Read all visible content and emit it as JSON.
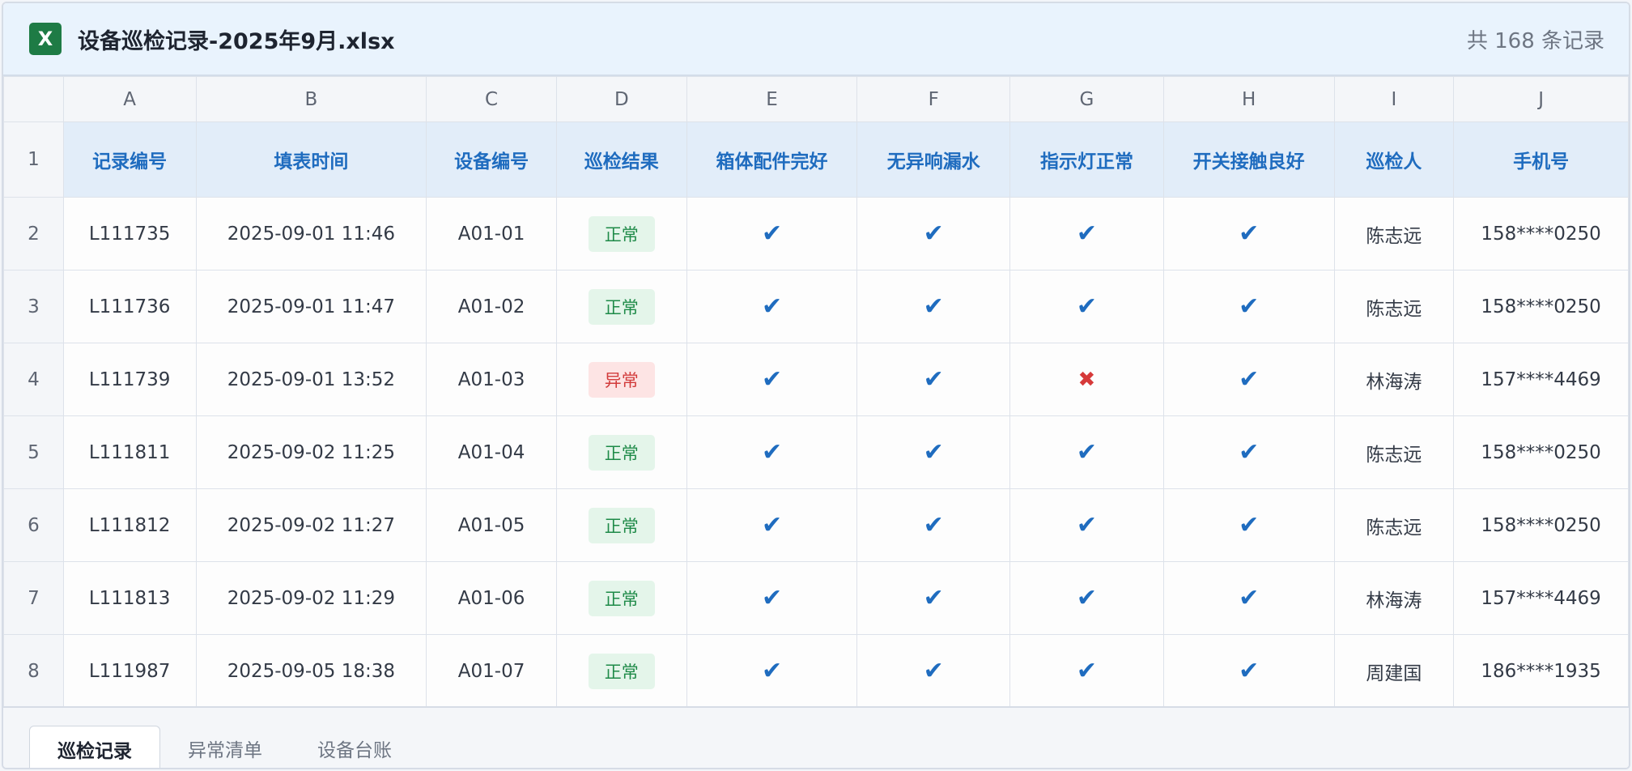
{
  "window": {
    "title": "设备巡检记录-2025年9月.xlsx",
    "icon_letter": "X",
    "record_count": "共 168 条记录"
  },
  "columns": [
    "A",
    "B",
    "C",
    "D",
    "E",
    "F",
    "G",
    "H",
    "I",
    "J"
  ],
  "headers": [
    "记录编号",
    "填表时间",
    "设备编号",
    "巡检结果",
    "箱体配件完好",
    "无异响漏水",
    "指示灯正常",
    "开关接触良好",
    "巡检人",
    "手机号"
  ],
  "rows": [
    {
      "num": "2",
      "id": "L111735",
      "time": "2025-09-01 11:46",
      "device": "A01-01",
      "result": "正常",
      "status": "ok",
      "checks": [
        true,
        true,
        true,
        true
      ],
      "inspector": "陈志远",
      "phone": "158****0250"
    },
    {
      "num": "3",
      "id": "L111736",
      "time": "2025-09-01 11:47",
      "device": "A01-02",
      "result": "正常",
      "status": "ok",
      "checks": [
        true,
        true,
        true,
        true
      ],
      "inspector": "陈志远",
      "phone": "158****0250"
    },
    {
      "num": "4",
      "id": "L111739",
      "time": "2025-09-01 13:52",
      "device": "A01-03",
      "result": "异常",
      "status": "bad",
      "checks": [
        true,
        true,
        false,
        true
      ],
      "inspector": "林海涛",
      "phone": "157****4469"
    },
    {
      "num": "5",
      "id": "L111811",
      "time": "2025-09-02 11:25",
      "device": "A01-04",
      "result": "正常",
      "status": "ok",
      "checks": [
        true,
        true,
        true,
        true
      ],
      "inspector": "陈志远",
      "phone": "158****0250"
    },
    {
      "num": "6",
      "id": "L111812",
      "time": "2025-09-02 11:27",
      "device": "A01-05",
      "result": "正常",
      "status": "ok",
      "checks": [
        true,
        true,
        true,
        true
      ],
      "inspector": "陈志远",
      "phone": "158****0250"
    },
    {
      "num": "7",
      "id": "L111813",
      "time": "2025-09-02 11:29",
      "device": "A01-06",
      "result": "正常",
      "status": "ok",
      "checks": [
        true,
        true,
        true,
        true
      ],
      "inspector": "林海涛",
      "phone": "157****4469"
    },
    {
      "num": "8",
      "id": "L111987",
      "time": "2025-09-05 18:38",
      "device": "A01-07",
      "result": "正常",
      "status": "ok",
      "checks": [
        true,
        true,
        true,
        true
      ],
      "inspector": "周建国",
      "phone": "186****1935"
    }
  ],
  "header_row_num": "1",
  "check_glyph": "✔",
  "cross_glyph": "✖",
  "sheet_tabs": [
    {
      "label": "巡检记录",
      "active": true
    },
    {
      "label": "异常清单",
      "active": false
    },
    {
      "label": "设备台账",
      "active": false
    }
  ],
  "colors": {
    "accent_blue": "#1f6cbf",
    "excel_green": "#1e7b45",
    "ok_green": "#1e8a48",
    "bad_red": "#d23b3b"
  }
}
